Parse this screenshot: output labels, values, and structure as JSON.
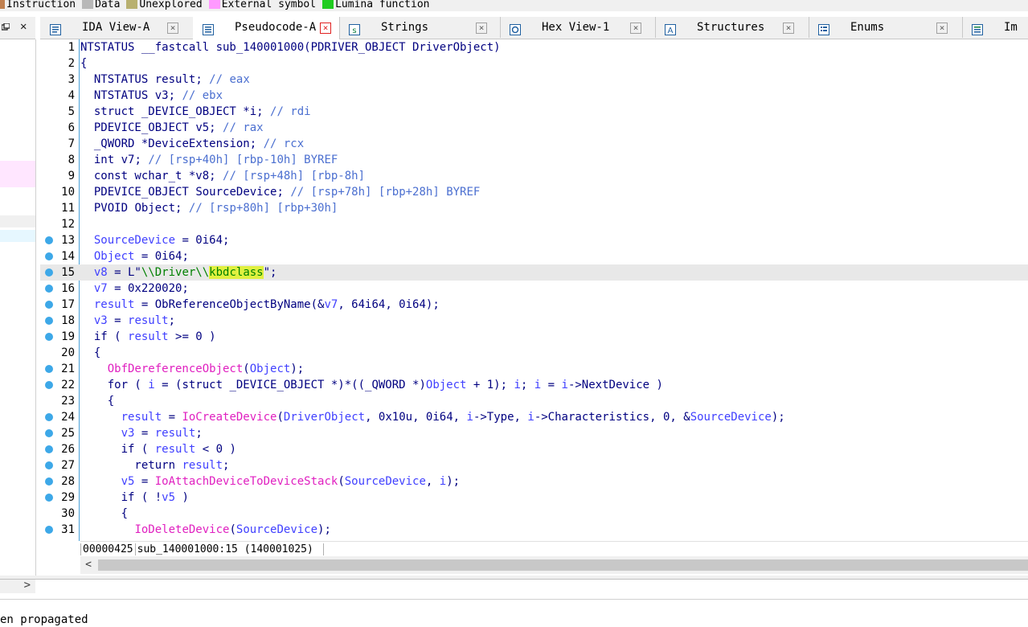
{
  "legend": [
    {
      "label": "Instruction",
      "color": "#c08050"
    },
    {
      "label": "Data",
      "color": "#b8b8b8"
    },
    {
      "label": "Unexplored",
      "color": "#b8b070"
    },
    {
      "label": "External symbol",
      "color": "#ff99ff"
    },
    {
      "label": "Lumina function",
      "color": "#20cc20"
    }
  ],
  "left_panel": {
    "pin_icon": "pin-icon",
    "close_icon": "close-icon"
  },
  "tabs": [
    {
      "label": "IDA View-A",
      "icon": "ida-view-icon",
      "close": "×"
    },
    {
      "label": "Pseudocode-A",
      "icon": "pseudocode-icon",
      "close": "×",
      "active": true
    },
    {
      "label": "Strings",
      "icon": "strings-icon",
      "close": "×"
    },
    {
      "label": "Hex View-1",
      "icon": "hex-view-icon",
      "close": "×"
    },
    {
      "label": "Structures",
      "icon": "structures-icon",
      "close": "×"
    },
    {
      "label": "Enums",
      "icon": "enums-icon",
      "close": "×"
    },
    {
      "label": "Im",
      "icon": "imports-icon"
    }
  ],
  "code_lines": [
    {
      "n": "1",
      "bp": false,
      "html": "<span class=\"kw\">NTSTATUS __fastcall sub_140001000(PDRIVER_OBJECT DriverObject)</span>"
    },
    {
      "n": "2",
      "bp": false,
      "html": "{"
    },
    {
      "n": "3",
      "bp": false,
      "html": "  <span class=\"tp\">NTSTATUS</span> <span class=\"kw\">result</span>; <span class=\"cm\">// eax</span>"
    },
    {
      "n": "4",
      "bp": false,
      "html": "  <span class=\"tp\">NTSTATUS</span> <span class=\"kw\">v3</span>; <span class=\"cm\">// ebx</span>"
    },
    {
      "n": "5",
      "bp": false,
      "html": "  <span class=\"tp\">struct _DEVICE_OBJECT</span> *<span class=\"kw\">i</span>; <span class=\"cm\">// rdi</span>"
    },
    {
      "n": "6",
      "bp": false,
      "html": "  <span class=\"tp\">PDEVICE_OBJECT</span> <span class=\"kw\">v5</span>; <span class=\"cm\">// rax</span>"
    },
    {
      "n": "7",
      "bp": false,
      "html": "  <span class=\"tp\">_QWORD</span> *<span class=\"kw\">DeviceExtension</span>; <span class=\"cm\">// rcx</span>"
    },
    {
      "n": "8",
      "bp": false,
      "html": "  <span class=\"tp\">int</span> <span class=\"kw\">v7</span>; <span class=\"cm\">// [rsp+40h] [rbp-10h] BYREF</span>"
    },
    {
      "n": "9",
      "bp": false,
      "html": "  <span class=\"tp\">const wchar_t</span> *<span class=\"kw\">v8</span>; <span class=\"cm\">// [rsp+48h] [rbp-8h]</span>"
    },
    {
      "n": "10",
      "bp": false,
      "html": "  <span class=\"tp\">PDEVICE_OBJECT</span> <span class=\"kw\">SourceDevice</span>; <span class=\"cm\">// [rsp+78h] [rbp+28h] BYREF</span>"
    },
    {
      "n": "11",
      "bp": false,
      "html": "  <span class=\"tp\">PVOID</span> <span class=\"kw\">Object</span>; <span class=\"cm\">// [rsp+80h] [rbp+30h]</span>"
    },
    {
      "n": "12",
      "bp": false,
      "html": ""
    },
    {
      "n": "13",
      "bp": true,
      "html": "  <span class=\"vr\">SourceDevice</span> = 0i64;"
    },
    {
      "n": "14",
      "bp": true,
      "html": "  <span class=\"vr\">Object</span> = 0i64;"
    },
    {
      "n": "15",
      "bp": true,
      "cur": true,
      "html": "  <span class=\"vr\">v8</span> = L\"<span class=\"st\">\\\\Driver\\\\</span><span class=\"st hl\">kbdclass</span>\";"
    },
    {
      "n": "16",
      "bp": true,
      "html": "  <span class=\"vr\">v7</span> = 0x220020;"
    },
    {
      "n": "17",
      "bp": true,
      "html": "  <span class=\"vr\">result</span> = ObReferenceObjectByName(&amp;<span class=\"vr\">v7</span>, 64i64, 0i64);"
    },
    {
      "n": "18",
      "bp": true,
      "html": "  <span class=\"vr\">v3</span> = <span class=\"vr\">result</span>;"
    },
    {
      "n": "19",
      "bp": true,
      "html": "  if ( <span class=\"vr\">result</span> &gt;= 0 )"
    },
    {
      "n": "20",
      "bp": false,
      "html": "  {"
    },
    {
      "n": "21",
      "bp": true,
      "html": "    <span class=\"fn\">ObfDereferenceObject</span>(<span class=\"vr\">Object</span>);"
    },
    {
      "n": "22",
      "bp": true,
      "html": "    for ( <span class=\"vr\">i</span> = (struct _DEVICE_OBJECT *)*((_QWORD *)<span class=\"vr\">Object</span> + 1); <span class=\"vr\">i</span>; <span class=\"vr\">i</span> = <span class=\"vr\">i</span>-&gt;NextDevice )"
    },
    {
      "n": "23",
      "bp": false,
      "html": "    {"
    },
    {
      "n": "24",
      "bp": true,
      "html": "      <span class=\"vr\">result</span> = <span class=\"fn\">IoCreateDevice</span>(<span class=\"vr\">DriverObject</span>, 0x10u, 0i64, <span class=\"vr\">i</span>-&gt;Type, <span class=\"vr\">i</span>-&gt;Characteristics, 0, &amp;<span class=\"vr\">SourceDevice</span>);"
    },
    {
      "n": "25",
      "bp": true,
      "html": "      <span class=\"vr\">v3</span> = <span class=\"vr\">result</span>;"
    },
    {
      "n": "26",
      "bp": true,
      "html": "      if ( <span class=\"vr\">result</span> &lt; 0 )"
    },
    {
      "n": "27",
      "bp": true,
      "html": "        return <span class=\"vr\">result</span>;"
    },
    {
      "n": "28",
      "bp": true,
      "html": "      <span class=\"vr\">v5</span> = <span class=\"fn\">IoAttachDeviceToDeviceStack</span>(<span class=\"vr\">SourceDevice</span>, <span class=\"vr\">i</span>);"
    },
    {
      "n": "29",
      "bp": true,
      "html": "      if ( !<span class=\"vr\">v5</span> )"
    },
    {
      "n": "30",
      "bp": false,
      "html": "      {"
    },
    {
      "n": "31",
      "bp": true,
      "html": "        <span class=\"fn\">IoDeleteDevice</span>(<span class=\"vr\">SourceDevice</span>);"
    }
  ],
  "status": {
    "offset": "00000425",
    "location": "sub_140001000:15",
    "address": "(140001025)"
  },
  "scroll_left_arrow": "<",
  "left_scroll_arrow": ">",
  "output_text": "en propagated"
}
